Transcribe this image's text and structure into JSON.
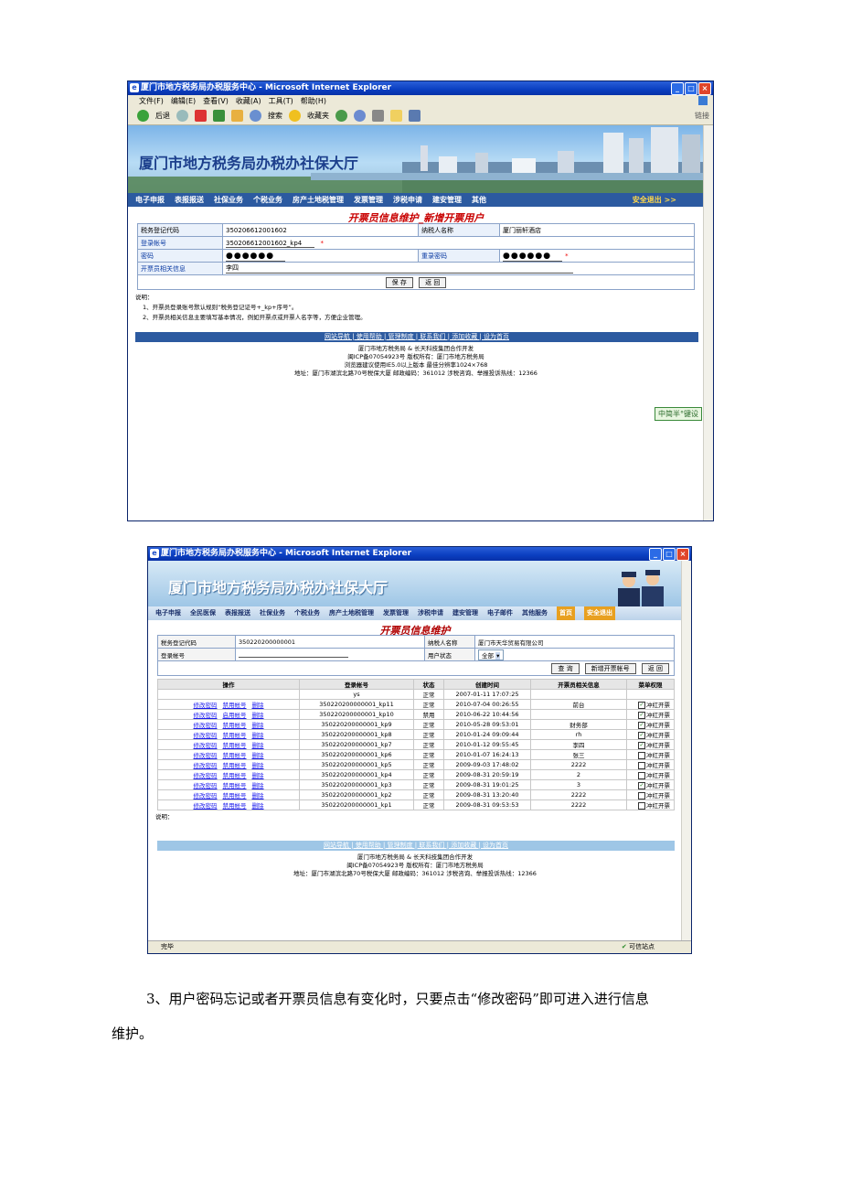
{
  "s1": {
    "window_title": "厦门市地方税务局办税服务中心 - Microsoft Internet Explorer",
    "menu": [
      "文件(F)",
      "编辑(E)",
      "查看(V)",
      "收藏(A)",
      "工具(T)",
      "帮助(H)"
    ],
    "toolbar": {
      "back": "后退",
      "search": "搜索",
      "favorites": "收藏夹",
      "links": "链接"
    },
    "banner_title": "厦门市地方税务局办税办社保大厅",
    "nav": [
      "电子申报",
      "表报报送",
      "社保业务",
      "个税业务",
      "房产土地税管理",
      "发票管理",
      "涉税申请",
      "建安管理",
      "其他"
    ],
    "nav_exit": "安全退出 >>",
    "page_title": "开票员信息维护_新增开票用户",
    "form": {
      "tax_code_label": "税务登记代码",
      "tax_code_value": "350206612001602",
      "taxpayer_label": "纳税人名称",
      "taxpayer_value": "厦门丽轩酒店",
      "login_label": "登录帐号",
      "login_value": "350206612001602_kp4",
      "pwd_label": "密码",
      "pwd_value": "●●●●●●",
      "repwd_label": "重录密码",
      "repwd_value": "●●●●●●",
      "info_label": "开票员相关信息",
      "info_value": "李四",
      "required_mark": "*",
      "save": "保 存",
      "back": "返 回"
    },
    "notes_title": "说明：",
    "notes": [
      "1、开票员登录账号默认规则“税务登记证号+_kp+序号”。",
      "2、开票员相关信息主要填写基本情况，例如开票点或开票人名字等，方便企业管理。"
    ],
    "footer_links": "网站导航 | 使用帮助 | 管理制度 | 联系我们 | 添加收藏 | 设为首页",
    "footer_lines": [
      "厦门市地方税务局 & 长天科技集团合作开发",
      "闽ICP备07054923号  版权所有：厦门市地方税务局",
      "浏览器建议使用IE5.0以上版本 最佳分辨率1024×768",
      "地址：厦门市湖滨北路70号税保大厦   邮政编码：361012   涉税咨询、举报投诉热线：12366"
    ],
    "badge": "中简半°键设"
  },
  "s2": {
    "window_title": "厦门市地方税务局办税服务中心 - Microsoft Internet Explorer",
    "banner_title": "厦门市地方税务局办税办社保大厅",
    "nav": [
      "电子申报",
      "全民医保",
      "表报报送",
      "社保业务",
      "个税业务",
      "房产土地税管理",
      "发票管理",
      "涉税申请",
      "建安管理",
      "电子邮件",
      "其他服务"
    ],
    "nav_home": "首页",
    "nav_exit": "安全退出",
    "page_title": "开票员信息维护",
    "filter": {
      "tax_code_label": "税务登记代码",
      "tax_code_value": "350220200000001",
      "taxpayer_label": "纳税人名称",
      "taxpayer_value": "厦门市天华贸易有限公司",
      "login_label": "登录帐号",
      "status_label": "用户状态",
      "status_value": "全部",
      "query": "查 询",
      "add": "新增开票帐号",
      "back": "返 回"
    },
    "headers": [
      "操作",
      "登录帐号",
      "状态",
      "创建时间",
      "开票员相关信息",
      "菜单权限"
    ],
    "ops": [
      "修改密码",
      "禁用帐号",
      "删除"
    ],
    "ops_enable": "启用帐号",
    "perm_label": "冲红开票",
    "rows": [
      {
        "ops": false,
        "account": "ys",
        "status": "正常",
        "created": "2007-01-11 17:07:25",
        "info": "",
        "perm": null,
        "enable": false
      },
      {
        "ops": true,
        "account": "350220200000001_kp11",
        "status": "正常",
        "created": "2010-07-04 00:26:55",
        "info": "前台",
        "perm": true,
        "enable": false
      },
      {
        "ops": true,
        "account": "350220200000001_kp10",
        "status": "禁用",
        "created": "2010-06-22 10:44:56",
        "info": "",
        "perm": true,
        "enable": true
      },
      {
        "ops": true,
        "account": "350220200000001_kp9",
        "status": "正常",
        "created": "2010-05-28 09:53:01",
        "info": "财务部",
        "perm": true,
        "enable": false
      },
      {
        "ops": true,
        "account": "350220200000001_kp8",
        "status": "正常",
        "created": "2010-01-24 09:09:44",
        "info": "rh",
        "perm": true,
        "enable": false
      },
      {
        "ops": true,
        "account": "350220200000001_kp7",
        "status": "正常",
        "created": "2010-01-12 09:55:45",
        "info": "李四",
        "perm": true,
        "enable": false
      },
      {
        "ops": true,
        "account": "350220200000001_kp6",
        "status": "正常",
        "created": "2010-01-07 16:24:13",
        "info": "张三",
        "perm": false,
        "enable": false
      },
      {
        "ops": true,
        "account": "350220200000001_kp5",
        "status": "正常",
        "created": "2009-09-03 17:48:02",
        "info": "2222",
        "perm": false,
        "enable": false
      },
      {
        "ops": true,
        "account": "350220200000001_kp4",
        "status": "正常",
        "created": "2009-08-31 20:59:19",
        "info": "2",
        "perm": false,
        "enable": false
      },
      {
        "ops": true,
        "account": "350220200000001_kp3",
        "status": "正常",
        "created": "2009-08-31 19:01:25",
        "info": "3",
        "perm": true,
        "enable": false
      },
      {
        "ops": true,
        "account": "350220200000001_kp2",
        "status": "正常",
        "created": "2009-08-31 13:20:40",
        "info": "2222",
        "perm": false,
        "enable": false
      },
      {
        "ops": true,
        "account": "350220200000001_kp1",
        "status": "正常",
        "created": "2009-08-31 09:53:53",
        "info": "2222",
        "perm": false,
        "enable": false
      }
    ],
    "notes_title": "说明：",
    "footer_links": "网站导航 | 使用帮助 | 管理制度 | 联系我们 | 添加收藏 | 设为首页",
    "footer_lines": [
      "厦门市地方税务局 & 长天科技集团合作开发",
      "闽ICP备07054923号  版权所有：厦门市地方税务局",
      "地址：厦门市湖滨北路70号税保大厦   邮政编码：361012   涉税咨询、举报投诉热线：12366"
    ],
    "status_left": "完毕",
    "status_right": "可信站点"
  },
  "caption_line1": "3、用户密码忘记或者开票员信息有变化时，只要点击“修改密码”即可进入进行信息",
  "caption_line2": "维护。",
  "colors": {
    "xp_blue": "#0a3ec0",
    "nav_bar": "#2c5aa0",
    "title_red": "#c80000",
    "link_blue": "#1a1aee"
  }
}
